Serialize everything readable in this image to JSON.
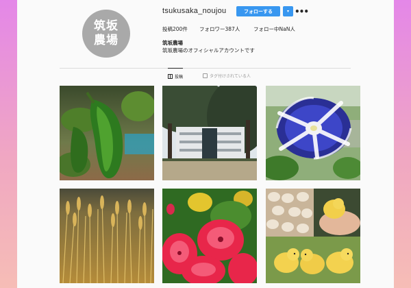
{
  "profile": {
    "avatar_line1": "筑坂",
    "avatar_line2": "農場",
    "username": "tsukusaka_noujou",
    "follow_label": "フォローする",
    "dropdown_label": "▾",
    "more_label": "•••",
    "stats": {
      "posts": "投稿200件",
      "followers": "フォロワー387人",
      "following": "フォロー中NaN人"
    },
    "full_name": "筑坂農場",
    "bio": "筑坂農場のオフィシャルアカウントです"
  },
  "tabs": {
    "posts_label": "投稿",
    "tagged_label": "タグ付けされている人"
  },
  "posts": [
    {
      "icon": "green-peppers-photo"
    },
    {
      "icon": "school-building-photo"
    },
    {
      "icon": "morning-glory-photo"
    },
    {
      "icon": "wheat-field-photo"
    },
    {
      "icon": "red-dianthus-photo"
    },
    {
      "icon": "chicks-photo"
    }
  ],
  "colors": {
    "accent": "#3897f0",
    "avatar_bg": "#a9a9a9"
  }
}
